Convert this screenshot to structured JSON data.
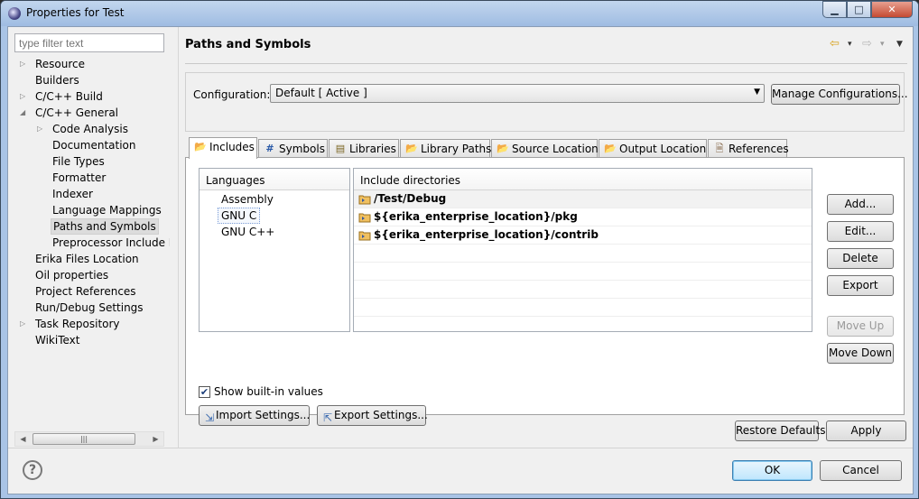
{
  "window": {
    "title": "Properties for Test",
    "min_glyph": "▁",
    "max_glyph": "□",
    "close_glyph": "✕"
  },
  "filter": {
    "placeholder": "type filter text"
  },
  "tree": {
    "twisty_collapsed": "▷",
    "twisty_expanded": "◢",
    "items": [
      {
        "label": "Resource"
      },
      {
        "label": "Builders"
      },
      {
        "label": "C/C++ Build"
      },
      {
        "label": "C/C++ General"
      },
      {
        "label": "Code Analysis"
      },
      {
        "label": "Documentation"
      },
      {
        "label": "File Types"
      },
      {
        "label": "Formatter"
      },
      {
        "label": "Indexer"
      },
      {
        "label": "Language Mappings"
      },
      {
        "label": "Paths and Symbols"
      },
      {
        "label": "Preprocessor Include Pa"
      },
      {
        "label": "Erika Files Location"
      },
      {
        "label": "Oil properties"
      },
      {
        "label": "Project References"
      },
      {
        "label": "Run/Debug Settings"
      },
      {
        "label": "Task Repository"
      },
      {
        "label": "WikiText"
      }
    ],
    "scroll_left": "◀",
    "scroll_right": "▶",
    "scroll_thumb": "|||"
  },
  "page": {
    "title": "Paths and Symbols"
  },
  "nav": {
    "back": "⇦",
    "back_menu": "▾",
    "forward": "⇨",
    "forward_menu": "▾",
    "view_menu": "▼"
  },
  "configuration": {
    "label": "Configuration:",
    "value": "Default  [ Active ]",
    "caret": "▼",
    "manage_button": "Manage Configurations..."
  },
  "tabs": [
    {
      "label": "Includes",
      "icon": "📂"
    },
    {
      "label": "Symbols",
      "icon": "#"
    },
    {
      "label": "Libraries",
      "icon": "▤"
    },
    {
      "label": "Library Paths",
      "icon": "📂"
    },
    {
      "label": "Source Location",
      "icon": "📂"
    },
    {
      "label": "Output Location",
      "icon": "📂"
    },
    {
      "label": "References",
      "icon": "🗎"
    }
  ],
  "languages": {
    "header": "Languages",
    "items": [
      "Assembly",
      "GNU C",
      "GNU C++"
    ]
  },
  "includes": {
    "header": "Include directories",
    "rows": [
      "/Test/Debug",
      "${erika_enterprise_location}/pkg",
      "${erika_enterprise_location}/contrib"
    ]
  },
  "side_buttons": {
    "add": "Add...",
    "edit": "Edit...",
    "delete": "Delete",
    "export": "Export",
    "move_up": "Move Up",
    "move_down": "Move Down"
  },
  "show_builtin": {
    "label": "Show built-in values",
    "checked": true,
    "mark": "✔"
  },
  "import_settings": "Import Settings...",
  "export_settings": "Export Settings...",
  "restore_defaults": "Restore Defaults",
  "apply": "Apply",
  "ok": "OK",
  "cancel": "Cancel",
  "help_glyph": "?"
}
